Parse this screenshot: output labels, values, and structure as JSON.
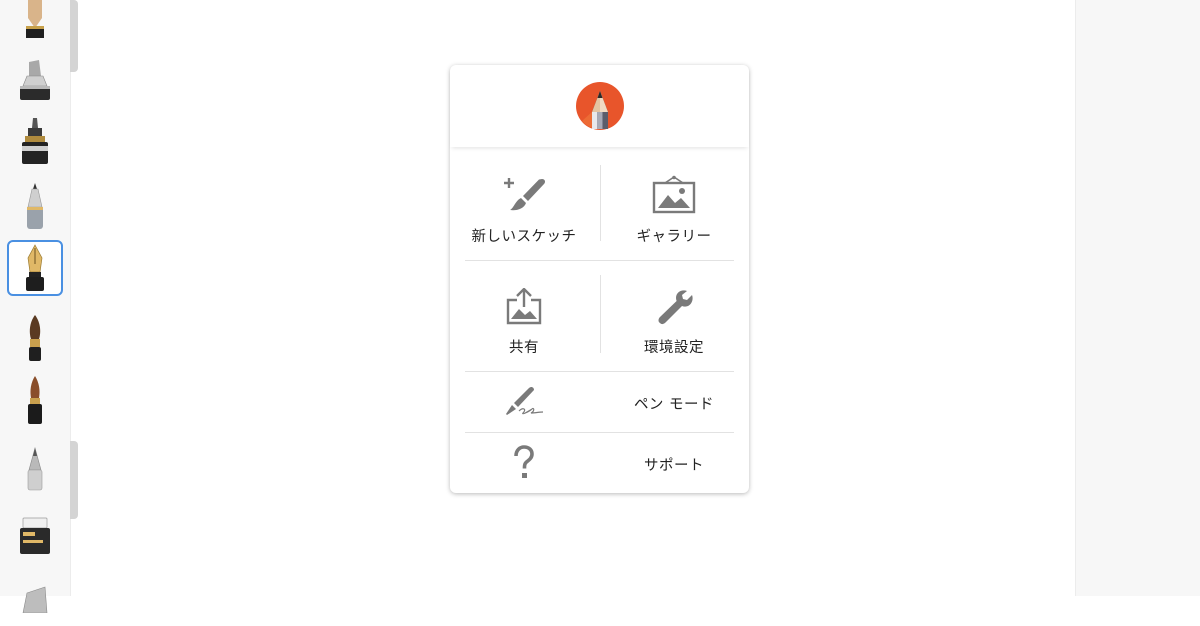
{
  "menu": {
    "new_sketch": "新しいスケッチ",
    "gallery": "ギャラリー",
    "share": "共有",
    "preferences": "環境設定",
    "pen_mode": "ペン モード",
    "support": "サポート"
  },
  "toolbar": {
    "brushes": [
      "pencil",
      "marker",
      "inking-pen",
      "ballpoint-pen",
      "fountain-pen",
      "paintbrush",
      "brush-pen",
      "airbrush",
      "eraser",
      "chisel-marker"
    ],
    "selected": "fountain-pen"
  },
  "colors": {
    "accent": "#4a90e2",
    "logo": "#e8552b",
    "icon": "#7a7a7a"
  }
}
